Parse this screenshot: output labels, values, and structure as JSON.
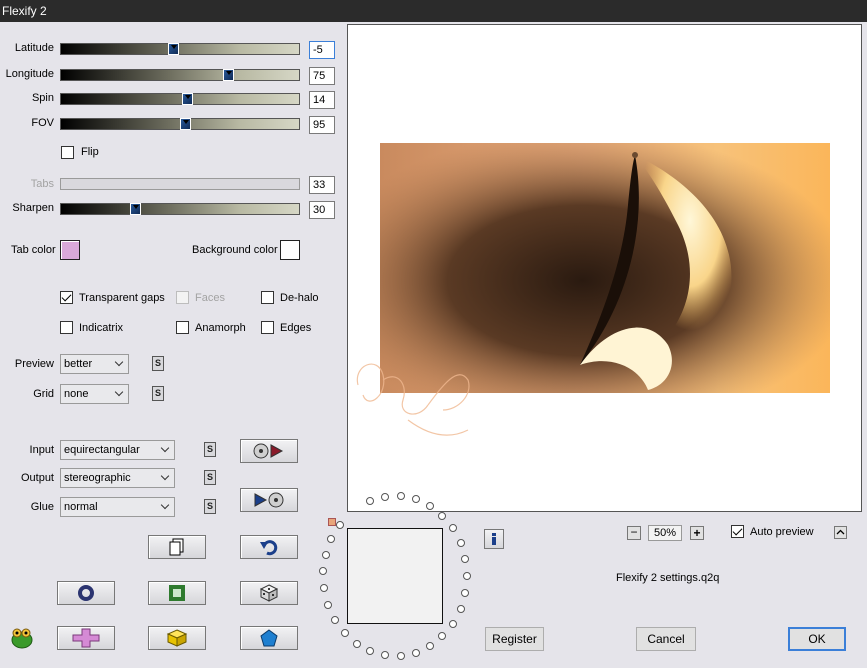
{
  "window": {
    "title": "Flexify 2"
  },
  "sliders": [
    {
      "id": "latitude",
      "label": "Latitude",
      "value": "-5",
      "fraction": 0.47
    },
    {
      "id": "longitude",
      "label": "Longitude",
      "value": "75",
      "fraction": 0.7
    },
    {
      "id": "spin",
      "label": "Spin",
      "value": "14",
      "fraction": 0.53
    },
    {
      "id": "fov",
      "label": "FOV",
      "value": "95",
      "fraction": 0.52
    },
    {
      "id": "tabs",
      "label": "Tabs",
      "value": "33",
      "fraction": 0.0,
      "disabled": true
    },
    {
      "id": "sharpen",
      "label": "Sharpen",
      "value": "30",
      "fraction": 0.31
    }
  ],
  "flip": {
    "label": "Flip",
    "checked": false
  },
  "colors": {
    "tab_color_label": "Tab color",
    "tab_color": "#d9a9d9",
    "background_color_label": "Background color",
    "background_color": "#ffffff"
  },
  "options": {
    "transparent_gaps": {
      "label": "Transparent gaps",
      "checked": true
    },
    "faces": {
      "label": "Faces",
      "checked": false,
      "disabled": true
    },
    "de_halo": {
      "label": "De-halo",
      "checked": false
    },
    "indicatrix": {
      "label": "Indicatrix",
      "checked": false
    },
    "anamorph": {
      "label": "Anamorph",
      "checked": false
    },
    "edges": {
      "label": "Edges",
      "checked": false
    }
  },
  "dropdowns": {
    "preview": {
      "label": "Preview",
      "value": "better"
    },
    "grid": {
      "label": "Grid",
      "value": "none"
    },
    "input": {
      "label": "Input",
      "value": "equirectangular"
    },
    "output": {
      "label": "Output",
      "value": "stereographic"
    },
    "glue": {
      "label": "Glue",
      "value": "normal"
    }
  },
  "s_label": "S",
  "zoom": {
    "value": "50%",
    "minus": "−",
    "plus": "+"
  },
  "auto_preview": {
    "label": "Auto preview",
    "checked": true
  },
  "settings_file": "Flexify 2 settings.q2q",
  "buttons": {
    "register": "Register",
    "cancel": "Cancel",
    "ok": "OK"
  },
  "icons": {
    "swap_in": "disc-play-icon",
    "swap_out": "play-disc-icon",
    "copy": "copy-icon",
    "undo": "undo-icon",
    "ring": "ring-icon",
    "frame": "frame-icon",
    "dice": "dice-icon",
    "plugin": "frog-plugin-icon",
    "cross": "cross-icon",
    "cube": "cube-icon",
    "pentagon": "pentagon-icon",
    "info": "info-icon",
    "collapse": "caret-up-icon"
  },
  "accent": "#3b7fd8"
}
